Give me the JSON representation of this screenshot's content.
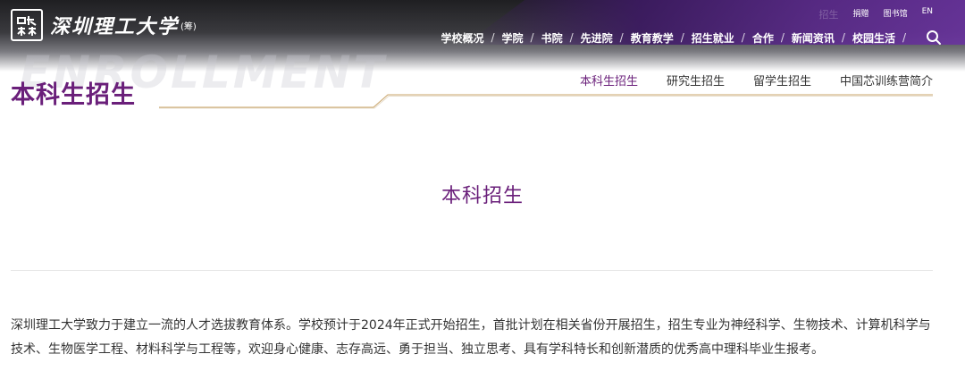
{
  "header": {
    "logo_text": "深圳理工大学",
    "logo_sub": "(筹)",
    "util_links": [
      "捐赠",
      "图书馆",
      "EN"
    ],
    "ghost_text": "招生"
  },
  "nav": {
    "items": [
      "学校概况",
      "学院",
      "书院",
      "先进院",
      "教育教学",
      "招生就业",
      "合作",
      "新闻资讯",
      "校园生活"
    ]
  },
  "section": {
    "watermark": "ENROLLMENT",
    "title": "本科生招生",
    "subnav": [
      "本科生招生",
      "研究生招生",
      "留学生招生",
      "中国芯训练营简介"
    ],
    "active_index": 0
  },
  "content": {
    "title": "本科招生",
    "body": "深圳理工大学致力于建立一流的人才选拔教育体系。学校预计于2024年正式开始招生，首批计划在相关省份开展招生，招生专业为神经科学、生物技术、计算机科学与技术、生物医学工程、材料科学与工程等，欢迎身心健康、志存高远、勇于担当、独立思考、具有学科特长和创新潜质的优秀高中理科毕业生报考。"
  },
  "colors": {
    "brand_purple": "#6a1f7a",
    "header_dark": "#1f1f22",
    "accent_gold": "#c9a46a"
  }
}
